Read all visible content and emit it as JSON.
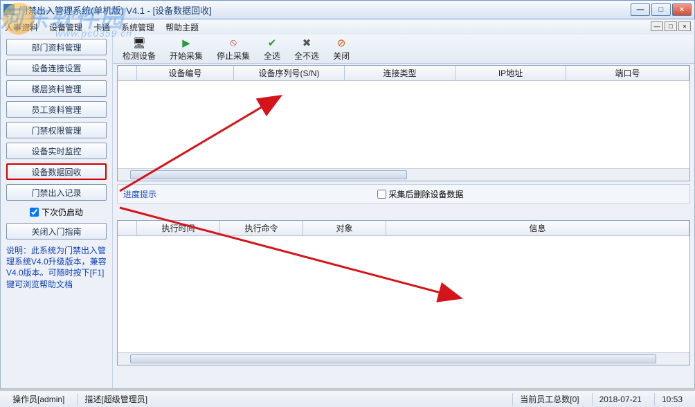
{
  "window": {
    "title": "门禁出入管理系统(单机版) V4.1 - [设备数据回收]",
    "min": "—",
    "max": "□",
    "close": "×"
  },
  "mdi": {
    "min": "—",
    "max": "□",
    "close": "×"
  },
  "menu": {
    "m1": "人事资料",
    "m2": "设备管理",
    "m3": "卡通",
    "m4": "系统管理",
    "m5": "帮助主题"
  },
  "sidebar": {
    "items": [
      "部门资料管理",
      "设备连接设置",
      "楼层资料管理",
      "员工资料管理",
      "门禁权限管理",
      "设备实时监控",
      "设备数据回收",
      "门禁出入记录"
    ],
    "next_start": "下次仍启动",
    "close_guide": "关闭入门指南",
    "note": "说明：此系统为门禁出入管理系统V4.0升级版本，兼容V4.0版本。可随时按下[F1]键可浏览帮助文档"
  },
  "toolbar": {
    "t1": "检测设备",
    "t2": "开始采集",
    "t3": "停止采集",
    "t4": "全选",
    "t5": "全不选",
    "t6": "关闭"
  },
  "grid1_headers": {
    "h0": "",
    "h1": "设备编号",
    "h2": "设备序列号(S/N)",
    "h3": "连接类型",
    "h4": "IP地址",
    "h5": "端口号"
  },
  "mid": {
    "progress": "进度提示",
    "chk": "采集后删除设备数据"
  },
  "grid2_headers": {
    "h0": "",
    "h1": "执行时间",
    "h2": "执行命令",
    "h3": "对象",
    "h4": "信息"
  },
  "status": {
    "operator_lbl": "操作员",
    "operator_val": "[admin]",
    "desc_lbl": "描述",
    "desc_val": "[超级管理员]",
    "emp": "当前员工总数[0]",
    "date": "2018-07-21",
    "time": "10:53"
  },
  "watermark": {
    "big": "河东软件园",
    "url": "www.pc0359.cn"
  }
}
